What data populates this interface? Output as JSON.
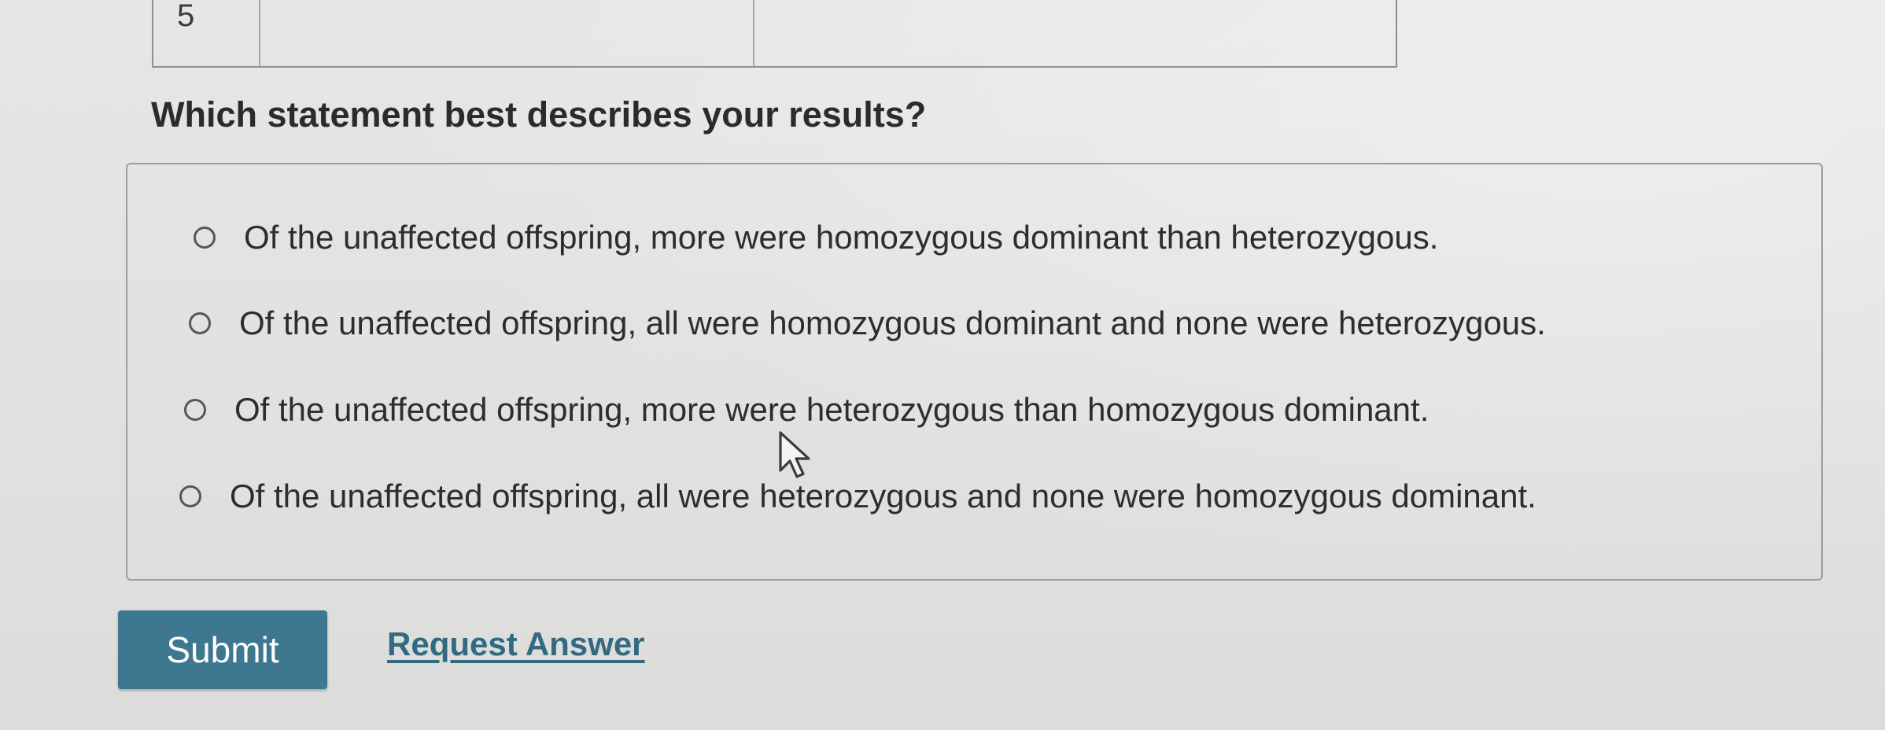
{
  "table": {
    "row_number": "5",
    "cells": [
      "",
      ""
    ]
  },
  "question": {
    "text": "Which statement best describes your results?"
  },
  "options": [
    {
      "label": "Of the unaffected offspring, more were homozygous dominant than heterozygous.",
      "selected": false
    },
    {
      "label": "Of the unaffected offspring, all were homozygous dominant and none were heterozygous.",
      "selected": false
    },
    {
      "label": "Of the unaffected offspring, more were heterozygous than homozygous dominant.",
      "selected": false
    },
    {
      "label": "Of the unaffected offspring, all were heterozygous and none were homozygous dominant.",
      "selected": false
    }
  ],
  "actions": {
    "submit_label": "Submit",
    "request_answer_label": "Request Answer"
  },
  "colors": {
    "submit_button": "#3d7890",
    "link": "#326a82",
    "background": "#e3e3e1"
  },
  "icons": {
    "cursor": "arrow-pointer-icon",
    "radio": "radio-unchecked-icon"
  }
}
